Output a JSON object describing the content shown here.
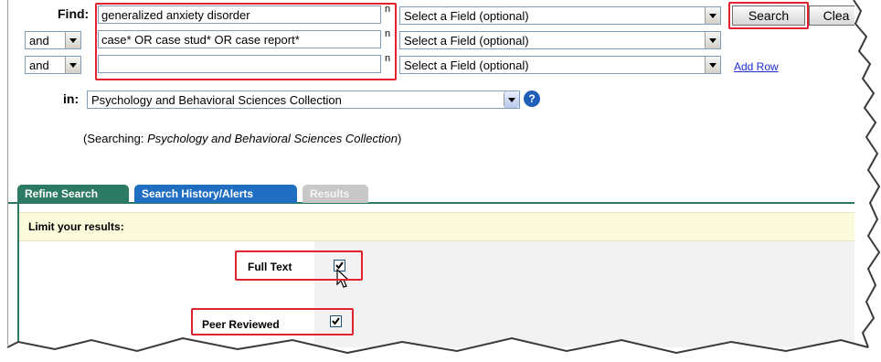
{
  "find_label": "Find:",
  "rows": [
    {
      "bool": "",
      "term": "generalized anxiety disorder",
      "in_char": "n",
      "field": "Select a Field (optional)"
    },
    {
      "bool": "and",
      "term": "case* OR case stud* OR case report*",
      "in_char": "n",
      "field": "Select a Field (optional)"
    },
    {
      "bool": "and",
      "term": "",
      "in_char": "n",
      "field": "Select a Field (optional)"
    }
  ],
  "search_button": "Search",
  "clear_button": "Clea",
  "add_row": "Add Row",
  "in_label": "in:",
  "database": "Psychology and Behavioral Sciences Collection",
  "help_icon": "?",
  "searching_prefix": "(Searching: ",
  "searching_db": "Psychology and Behavioral Sciences Collection",
  "searching_suffix": ")",
  "tabs": {
    "refine": "Refine Search",
    "history": "Search History/Alerts",
    "results": "Results"
  },
  "limit_title": "Limit your results:",
  "limiters": {
    "full_text": {
      "label": "Full Text",
      "checked": true
    },
    "peer_reviewed": {
      "label": "Peer Reviewed",
      "checked": true
    }
  },
  "colors": {
    "highlight": "#e0232e",
    "tab_refine": "#2c7a63",
    "tab_history": "#1f6ec2",
    "tab_results": "#c8c8c8",
    "limit_bg": "#fbfbdc",
    "link": "#1a2fd6"
  }
}
